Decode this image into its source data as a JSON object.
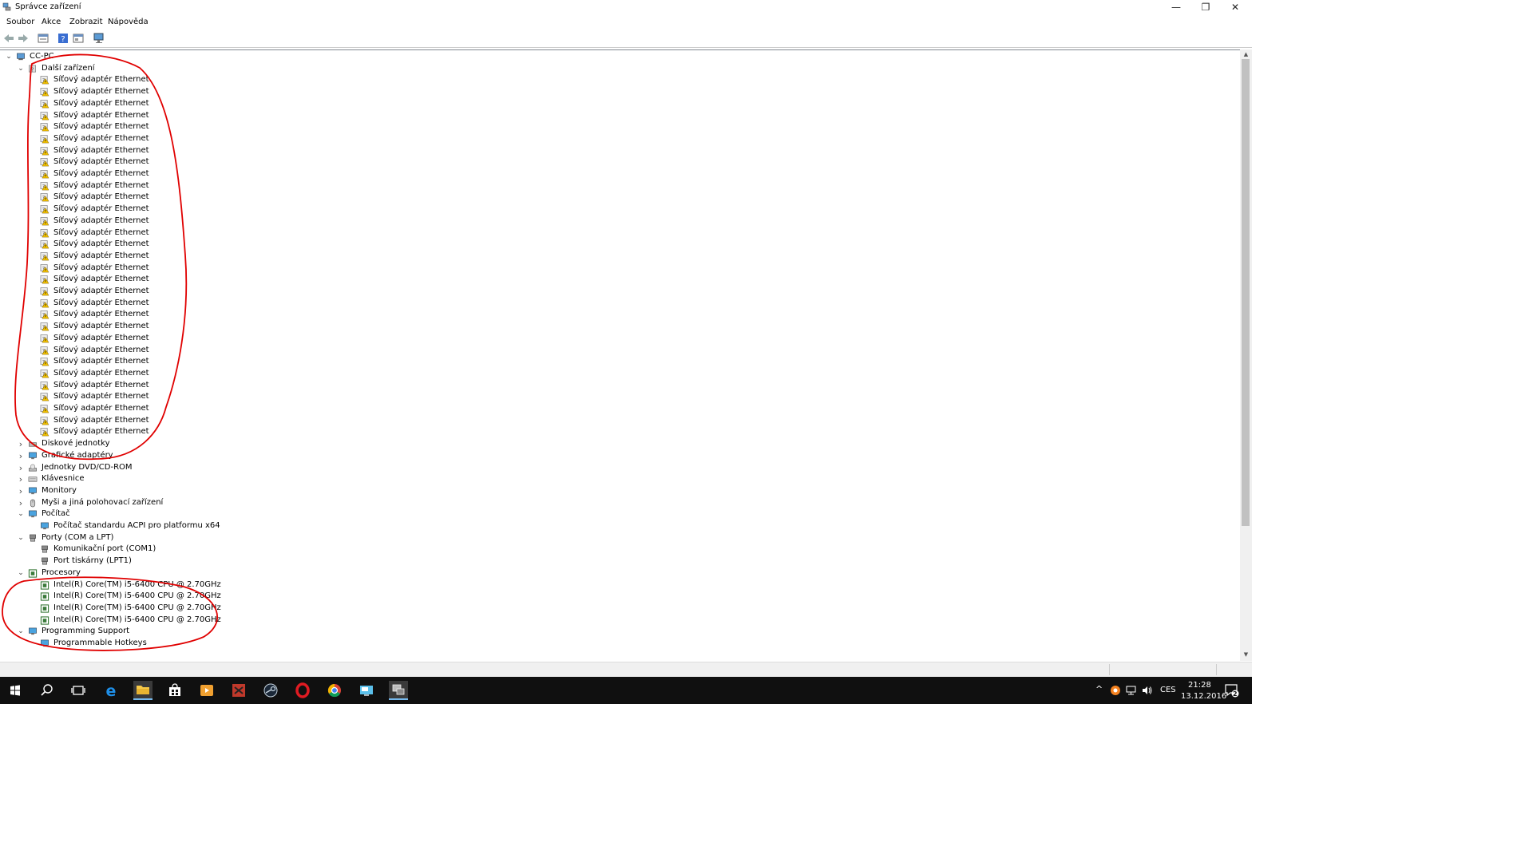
{
  "window": {
    "title": "Správce zařízení",
    "minimize_glyph": "—",
    "maximize_glyph": "❐",
    "close_glyph": "✕"
  },
  "menu": [
    "Soubor",
    "Akce",
    "Zobrazit",
    "Nápověda"
  ],
  "toolbar": {
    "buttons": [
      "back-arrow-icon",
      "forward-arrow-icon",
      "properties-icon",
      "help-icon",
      "show-hide-icon",
      "scan-hardware-icon"
    ]
  },
  "tree": {
    "root": "CC-PC",
    "other_devices": {
      "label": "Další zařízení",
      "items": [
        "Síťový adaptér Ethernet",
        "Síťový adaptér Ethernet",
        "Síťový adaptér Ethernet",
        "Síťový adaptér Ethernet",
        "Síťový adaptér Ethernet",
        "Síťový adaptér Ethernet",
        "Síťový adaptér Ethernet",
        "Síťový adaptér Ethernet",
        "Síťový adaptér Ethernet",
        "Síťový adaptér Ethernet",
        "Síťový adaptér Ethernet",
        "Síťový adaptér Ethernet",
        "Síťový adaptér Ethernet",
        "Síťový adaptér Ethernet",
        "Síťový adaptér Ethernet",
        "Síťový adaptér Ethernet",
        "Síťový adaptér Ethernet",
        "Síťový adaptér Ethernet",
        "Síťový adaptér Ethernet",
        "Síťový adaptér Ethernet",
        "Síťový adaptér Ethernet",
        "Síťový adaptér Ethernet",
        "Síťový adaptér Ethernet",
        "Síťový adaptér Ethernet",
        "Síťový adaptér Ethernet",
        "Síťový adaptér Ethernet",
        "Síťový adaptér Ethernet",
        "Síťový adaptér Ethernet",
        "Síťový adaptér Ethernet",
        "Síťový adaptér Ethernet",
        "Síťový adaptér Ethernet"
      ]
    },
    "categories_collapsed": [
      "Diskové jednotky",
      "Grafické adaptéry",
      "Jednotky DVD/CD-ROM",
      "Klávesnice",
      "Monitory",
      "Myši a jiná polohovací zařízení"
    ],
    "computer": {
      "label": "Počítač",
      "items": [
        "Počítač standardu ACPI pro platformu x64"
      ]
    },
    "ports": {
      "label": "Porty (COM a LPT)",
      "items": [
        "Komunikační port (COM1)",
        "Port tiskárny (LPT1)"
      ]
    },
    "processors": {
      "label": "Procesory",
      "items": [
        "Intel(R) Core(TM) i5-6400 CPU @ 2.70GHz",
        "Intel(R) Core(TM) i5-6400 CPU @ 2.70GHz",
        "Intel(R) Core(TM) i5-6400 CPU @ 2.70GHz",
        "Intel(R) Core(TM) i5-6400 CPU @ 2.70GHz"
      ]
    },
    "programming_support": {
      "label": "Programming Support",
      "items": [
        "Programmable Hotkeys"
      ]
    }
  },
  "taskbar": {
    "apps": [
      "start-icon",
      "search-icon",
      "task-view-icon",
      "edge-icon",
      "file-explorer-icon",
      "store-icon",
      "media-player-icon",
      "game-icon",
      "steam-icon",
      "opera-icon",
      "chrome-icon",
      "remote-desktop-icon",
      "device-manager-icon"
    ],
    "tray": {
      "chevron": "^",
      "language": "CES",
      "time": "21:28",
      "date": "13.12.2016",
      "notification_count": "2"
    }
  },
  "colors": {
    "annotation": "#e00000",
    "selection_accent": "#76b9ed",
    "taskbar": "#101010"
  }
}
